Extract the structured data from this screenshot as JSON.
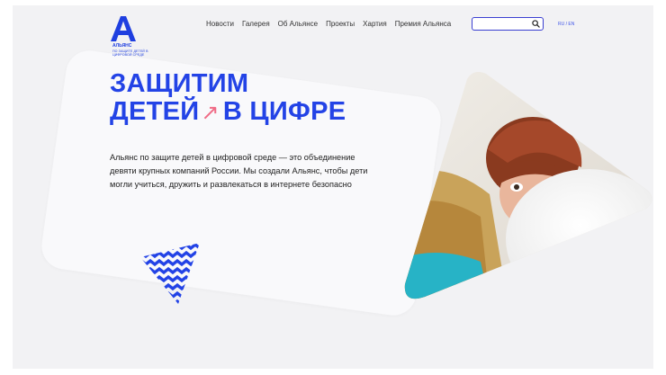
{
  "logo": {
    "name": "АЛЬЯНС",
    "tagline": "ПО ЗАЩИТЕ ДЕТЕЙ В ЦИФРОВОЙ СРЕДЕ",
    "color": "#1f3fe0"
  },
  "nav": {
    "items": [
      {
        "label": "Новости"
      },
      {
        "label": "Галерея"
      },
      {
        "label": "Об Альянсе"
      },
      {
        "label": "Проекты"
      },
      {
        "label": "Хартия"
      },
      {
        "label": "Премия Альянса"
      }
    ]
  },
  "search": {
    "value": "",
    "placeholder": "",
    "icon": "search-icon",
    "border_color": "#3a3fd1"
  },
  "lang": {
    "ru": "RU",
    "sep": " / ",
    "en": "EN"
  },
  "hero": {
    "title_line1": "ЗАЩИТИМ",
    "title_line2a": "ДЕТЕЙ",
    "arrow": "↗",
    "title_line2b": "В ЦИФРЕ",
    "text": "Альянс по защите детей в цифровой среде — это объединение девяти крупных компаний России. Мы создали Альянс, чтобы дети могли учиться, дружить и развлекаться в интернете безопасно",
    "title_color": "#2343e6",
    "arrow_color": "#f06b86"
  },
  "colors": {
    "page_bg": "#f2f2f4",
    "card_bg": "#f9f9fb",
    "accent": "#2343e6",
    "teal": "#27b3c6"
  }
}
